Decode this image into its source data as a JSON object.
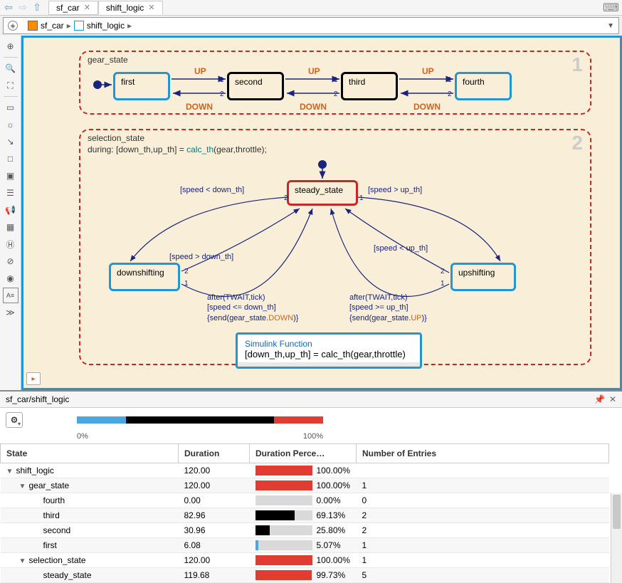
{
  "tabs": {
    "t1": "sf_car",
    "t2": "shift_logic"
  },
  "breadcrumb": {
    "a": "sf_car",
    "b": "shift_logic"
  },
  "gear_state": {
    "label": "gear_state",
    "first": "first",
    "second": "second",
    "third": "third",
    "fourth": "fourth",
    "up": "UP",
    "down": "DOWN"
  },
  "selection_state": {
    "label": "selection_state",
    "during": "during: [down_th,up_th] = ",
    "during_func": "calc_th",
    "during_args": "(gear,throttle);",
    "steady": "steady_state",
    "down": "downshifting",
    "up": "upshifting",
    "g1": "[speed < down_th]",
    "g2": "[speed > up_th]",
    "g3": "[speed > down_th]",
    "g4": "[speed < up_th]",
    "a1_l1": "after(TWAIT,tick)",
    "a1_l2": "[speed <= down_th]",
    "a1_l3a": "{send(gear_state.",
    "a1_l3b": "DOWN",
    "a1_l3c": ")}",
    "a2_l1": "after(TWAIT,tick)",
    "a2_l2": "[speed >= up_th]",
    "a2_l3a": "{send(gear_state.",
    "a2_l3b": "UP",
    "a2_l3c": ")}",
    "simfunc_title": "Simulink Function",
    "simfunc_body": "[down_th,up_th] = calc_th(gear,throttle)"
  },
  "panel": {
    "title": "sf_car/shift_logic",
    "pb_0": "0%",
    "pb_100": "100%",
    "h_state": "State",
    "h_dur": "Duration",
    "h_pct": "Duration Perce…",
    "h_num": "Number of Entries",
    "rows": [
      {
        "name": "shift_logic",
        "dur": "120.00",
        "pct": "100.00%",
        "num": "",
        "indent": 0,
        "exp": "▼",
        "fill": 100,
        "color": "#e03c31"
      },
      {
        "name": "gear_state",
        "dur": "120.00",
        "pct": "100.00%",
        "num": "1",
        "indent": 1,
        "exp": "▼",
        "fill": 100,
        "color": "#e03c31"
      },
      {
        "name": "fourth",
        "dur": "0.00",
        "pct": "0.00%",
        "num": "0",
        "indent": 2,
        "exp": "",
        "fill": 0,
        "color": "#000"
      },
      {
        "name": "third",
        "dur": "82.96",
        "pct": "69.13%",
        "num": "2",
        "indent": 2,
        "exp": "",
        "fill": 69,
        "color": "#000"
      },
      {
        "name": "second",
        "dur": "30.96",
        "pct": "25.80%",
        "num": "2",
        "indent": 2,
        "exp": "",
        "fill": 26,
        "color": "#000"
      },
      {
        "name": "first",
        "dur": "6.08",
        "pct": "5.07%",
        "num": "1",
        "indent": 2,
        "exp": "",
        "fill": 5,
        "color": "#4aa8e0"
      },
      {
        "name": "selection_state",
        "dur": "120.00",
        "pct": "100.00%",
        "num": "1",
        "indent": 1,
        "exp": "▼",
        "fill": 100,
        "color": "#e03c31"
      },
      {
        "name": "steady_state",
        "dur": "119.68",
        "pct": "99.73%",
        "num": "5",
        "indent": 2,
        "exp": "",
        "fill": 99,
        "color": "#e03c31"
      }
    ]
  }
}
